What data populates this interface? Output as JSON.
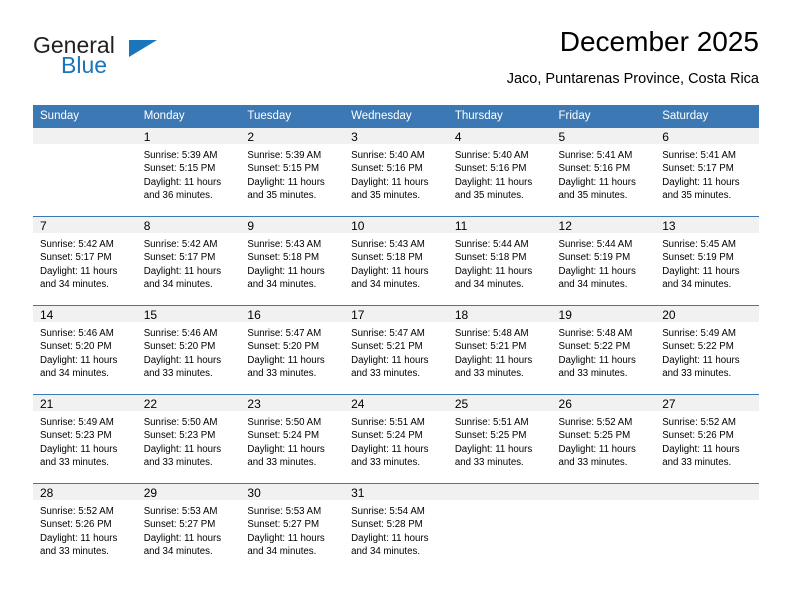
{
  "brand": {
    "name_part1": "General",
    "name_part2": "Blue",
    "triangle_icon": "triangle-icon",
    "accent_color": "#1b75bb"
  },
  "header": {
    "title": "December 2025",
    "subtitle": "Jaco, Puntarenas Province, Costa Rica"
  },
  "theme": {
    "header_blue": "#3c78b4",
    "day_band_gray": "#f1f1f1",
    "text_color": "#000000"
  },
  "calendar": {
    "weekday_headers": [
      "Sunday",
      "Monday",
      "Tuesday",
      "Wednesday",
      "Thursday",
      "Friday",
      "Saturday"
    ],
    "weeks": [
      [
        {
          "day": "",
          "blank": true,
          "sunrise": "",
          "sunset": "",
          "daylight_line1": "",
          "daylight_line2": ""
        },
        {
          "day": "1",
          "sunrise": "Sunrise: 5:39 AM",
          "sunset": "Sunset: 5:15 PM",
          "daylight_line1": "Daylight: 11 hours",
          "daylight_line2": "and 36 minutes."
        },
        {
          "day": "2",
          "sunrise": "Sunrise: 5:39 AM",
          "sunset": "Sunset: 5:15 PM",
          "daylight_line1": "Daylight: 11 hours",
          "daylight_line2": "and 35 minutes."
        },
        {
          "day": "3",
          "sunrise": "Sunrise: 5:40 AM",
          "sunset": "Sunset: 5:16 PM",
          "daylight_line1": "Daylight: 11 hours",
          "daylight_line2": "and 35 minutes."
        },
        {
          "day": "4",
          "sunrise": "Sunrise: 5:40 AM",
          "sunset": "Sunset: 5:16 PM",
          "daylight_line1": "Daylight: 11 hours",
          "daylight_line2": "and 35 minutes."
        },
        {
          "day": "5",
          "sunrise": "Sunrise: 5:41 AM",
          "sunset": "Sunset: 5:16 PM",
          "daylight_line1": "Daylight: 11 hours",
          "daylight_line2": "and 35 minutes."
        },
        {
          "day": "6",
          "sunrise": "Sunrise: 5:41 AM",
          "sunset": "Sunset: 5:17 PM",
          "daylight_line1": "Daylight: 11 hours",
          "daylight_line2": "and 35 minutes."
        }
      ],
      [
        {
          "day": "7",
          "sunrise": "Sunrise: 5:42 AM",
          "sunset": "Sunset: 5:17 PM",
          "daylight_line1": "Daylight: 11 hours",
          "daylight_line2": "and 34 minutes."
        },
        {
          "day": "8",
          "sunrise": "Sunrise: 5:42 AM",
          "sunset": "Sunset: 5:17 PM",
          "daylight_line1": "Daylight: 11 hours",
          "daylight_line2": "and 34 minutes."
        },
        {
          "day": "9",
          "sunrise": "Sunrise: 5:43 AM",
          "sunset": "Sunset: 5:18 PM",
          "daylight_line1": "Daylight: 11 hours",
          "daylight_line2": "and 34 minutes."
        },
        {
          "day": "10",
          "sunrise": "Sunrise: 5:43 AM",
          "sunset": "Sunset: 5:18 PM",
          "daylight_line1": "Daylight: 11 hours",
          "daylight_line2": "and 34 minutes."
        },
        {
          "day": "11",
          "sunrise": "Sunrise: 5:44 AM",
          "sunset": "Sunset: 5:18 PM",
          "daylight_line1": "Daylight: 11 hours",
          "daylight_line2": "and 34 minutes."
        },
        {
          "day": "12",
          "sunrise": "Sunrise: 5:44 AM",
          "sunset": "Sunset: 5:19 PM",
          "daylight_line1": "Daylight: 11 hours",
          "daylight_line2": "and 34 minutes."
        },
        {
          "day": "13",
          "sunrise": "Sunrise: 5:45 AM",
          "sunset": "Sunset: 5:19 PM",
          "daylight_line1": "Daylight: 11 hours",
          "daylight_line2": "and 34 minutes."
        }
      ],
      [
        {
          "day": "14",
          "sunrise": "Sunrise: 5:46 AM",
          "sunset": "Sunset: 5:20 PM",
          "daylight_line1": "Daylight: 11 hours",
          "daylight_line2": "and 34 minutes."
        },
        {
          "day": "15",
          "sunrise": "Sunrise: 5:46 AM",
          "sunset": "Sunset: 5:20 PM",
          "daylight_line1": "Daylight: 11 hours",
          "daylight_line2": "and 33 minutes."
        },
        {
          "day": "16",
          "sunrise": "Sunrise: 5:47 AM",
          "sunset": "Sunset: 5:20 PM",
          "daylight_line1": "Daylight: 11 hours",
          "daylight_line2": "and 33 minutes."
        },
        {
          "day": "17",
          "sunrise": "Sunrise: 5:47 AM",
          "sunset": "Sunset: 5:21 PM",
          "daylight_line1": "Daylight: 11 hours",
          "daylight_line2": "and 33 minutes."
        },
        {
          "day": "18",
          "sunrise": "Sunrise: 5:48 AM",
          "sunset": "Sunset: 5:21 PM",
          "daylight_line1": "Daylight: 11 hours",
          "daylight_line2": "and 33 minutes."
        },
        {
          "day": "19",
          "sunrise": "Sunrise: 5:48 AM",
          "sunset": "Sunset: 5:22 PM",
          "daylight_line1": "Daylight: 11 hours",
          "daylight_line2": "and 33 minutes."
        },
        {
          "day": "20",
          "sunrise": "Sunrise: 5:49 AM",
          "sunset": "Sunset: 5:22 PM",
          "daylight_line1": "Daylight: 11 hours",
          "daylight_line2": "and 33 minutes."
        }
      ],
      [
        {
          "day": "21",
          "sunrise": "Sunrise: 5:49 AM",
          "sunset": "Sunset: 5:23 PM",
          "daylight_line1": "Daylight: 11 hours",
          "daylight_line2": "and 33 minutes."
        },
        {
          "day": "22",
          "sunrise": "Sunrise: 5:50 AM",
          "sunset": "Sunset: 5:23 PM",
          "daylight_line1": "Daylight: 11 hours",
          "daylight_line2": "and 33 minutes."
        },
        {
          "day": "23",
          "sunrise": "Sunrise: 5:50 AM",
          "sunset": "Sunset: 5:24 PM",
          "daylight_line1": "Daylight: 11 hours",
          "daylight_line2": "and 33 minutes."
        },
        {
          "day": "24",
          "sunrise": "Sunrise: 5:51 AM",
          "sunset": "Sunset: 5:24 PM",
          "daylight_line1": "Daylight: 11 hours",
          "daylight_line2": "and 33 minutes."
        },
        {
          "day": "25",
          "sunrise": "Sunrise: 5:51 AM",
          "sunset": "Sunset: 5:25 PM",
          "daylight_line1": "Daylight: 11 hours",
          "daylight_line2": "and 33 minutes."
        },
        {
          "day": "26",
          "sunrise": "Sunrise: 5:52 AM",
          "sunset": "Sunset: 5:25 PM",
          "daylight_line1": "Daylight: 11 hours",
          "daylight_line2": "and 33 minutes."
        },
        {
          "day": "27",
          "sunrise": "Sunrise: 5:52 AM",
          "sunset": "Sunset: 5:26 PM",
          "daylight_line1": "Daylight: 11 hours",
          "daylight_line2": "and 33 minutes."
        }
      ],
      [
        {
          "day": "28",
          "sunrise": "Sunrise: 5:52 AM",
          "sunset": "Sunset: 5:26 PM",
          "daylight_line1": "Daylight: 11 hours",
          "daylight_line2": "and 33 minutes."
        },
        {
          "day": "29",
          "sunrise": "Sunrise: 5:53 AM",
          "sunset": "Sunset: 5:27 PM",
          "daylight_line1": "Daylight: 11 hours",
          "daylight_line2": "and 34 minutes."
        },
        {
          "day": "30",
          "sunrise": "Sunrise: 5:53 AM",
          "sunset": "Sunset: 5:27 PM",
          "daylight_line1": "Daylight: 11 hours",
          "daylight_line2": "and 34 minutes."
        },
        {
          "day": "31",
          "sunrise": "Sunrise: 5:54 AM",
          "sunset": "Sunset: 5:28 PM",
          "daylight_line1": "Daylight: 11 hours",
          "daylight_line2": "and 34 minutes."
        },
        {
          "day": "",
          "blank": true,
          "sunrise": "",
          "sunset": "",
          "daylight_line1": "",
          "daylight_line2": ""
        },
        {
          "day": "",
          "blank": true,
          "sunrise": "",
          "sunset": "",
          "daylight_line1": "",
          "daylight_line2": ""
        },
        {
          "day": "",
          "blank": true,
          "sunrise": "",
          "sunset": "",
          "daylight_line1": "",
          "daylight_line2": ""
        }
      ]
    ]
  }
}
